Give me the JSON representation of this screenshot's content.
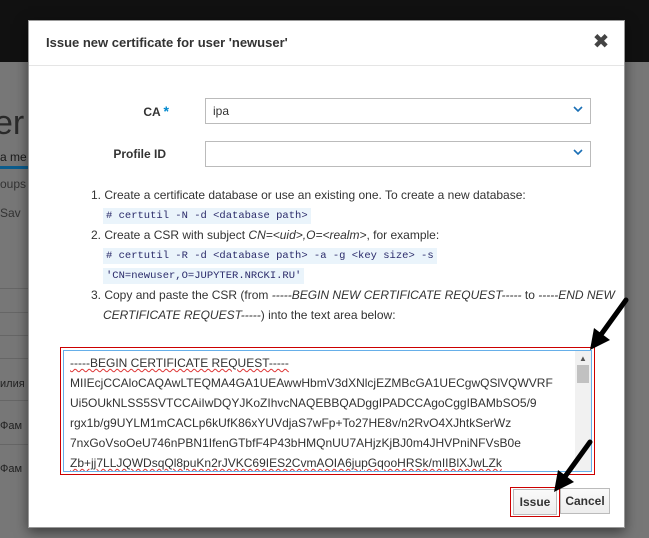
{
  "background": {
    "title_fragment": "er",
    "tab_fragment": "a me",
    "sub_fragment": "oups",
    "save_fragment": "Sav",
    "row1": "илия",
    "row2": "Фам",
    "row3": "Фам"
  },
  "modal": {
    "title": "Issue new certificate for user 'newuser'",
    "close_glyph": "✖"
  },
  "form": {
    "ca_label": "CA",
    "ca_required": "*",
    "ca_value": "ipa",
    "profile_label": "Profile ID",
    "profile_value": ""
  },
  "instructions": {
    "step1_text": "1. Create a certificate database or use an existing one. To create a new database:",
    "step1_code": "# certutil -N -d <database path>",
    "step2_prefix": "2. Create a CSR with subject ",
    "step2_subject": "CN=<uid>,O=<realm>",
    "step2_suffix": ", for example:",
    "step2_code1": "# certutil -R -d <database path> -a -g <key size> -s",
    "step2_code2": "'CN=newuser,O=JUPYTER.NRCKI.RU'",
    "step3_line1_prefix": "3. Copy and paste the CSR (from ",
    "step3_begin_marker": "-----BEGIN NEW CERTIFICATE REQUEST-----",
    "step3_to": " to ",
    "step3_end_marker_part1": "-----END NEW",
    "step3_end_marker_part2": "CERTIFICATE REQUEST-----",
    "step3_line2_suffix": ") into the text area below:"
  },
  "csr": {
    "lines": [
      "-----BEGIN CERTIFICATE REQUEST-----",
      "MIIEcjCCAloCAQAwLTEQMA4GA1UEAwwHbmV3dXNlcjEZMBcGA1UECgwQSlVQWVRF",
      "Ui5OUkNLSS5SVTCCAiIwDQYJKoZIhvcNAQEBBQADggIPADCCAgoCggIBAMbSO5/9",
      "rgx1b/g9UYLM1mCACLp6kUfK86xYUVdjaS7wFp+To27HE8v/n2RvO4XJhtkSerWz",
      "7nxGoVsoOeU746nPBN1IfenGTbfF4P43bHMQnUU7AHjzKjBJ0m4JHVPniNFVsB0e",
      "Zb+jj7LLJQWDsqQl8puKn2rJVKC69IES2CvmAOIA6jupGqooHRSk/mIIBlXJwLZk"
    ]
  },
  "buttons": {
    "issue": "Issue",
    "cancel": "Cancel"
  },
  "colors": {
    "accent": "#0088ce",
    "annotation_red": "#cc0000",
    "code_bg": "#eaf4fb"
  }
}
